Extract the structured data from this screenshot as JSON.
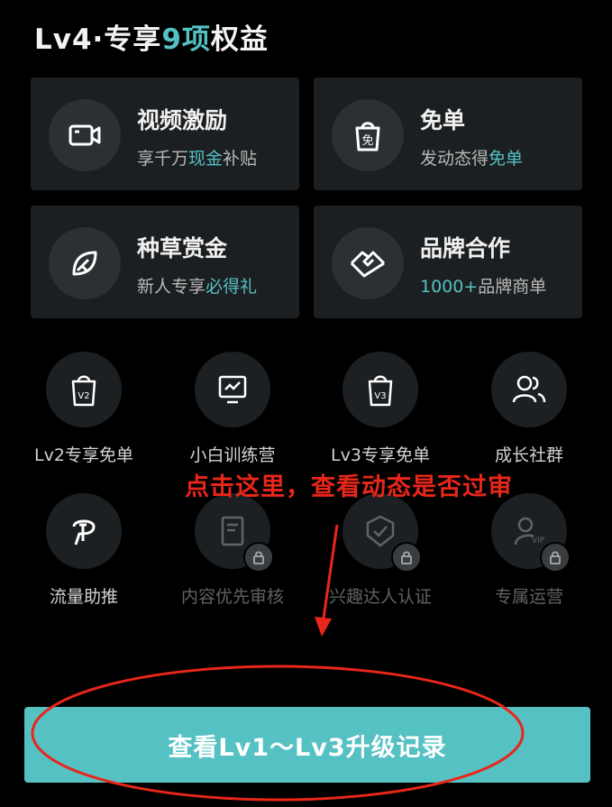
{
  "colors": {
    "accent": "#55c1c3",
    "annotation_red": "#e8261a",
    "background": "#000000",
    "card_bg": "#1c1f21"
  },
  "header": {
    "title_prefix": "Lv4·专享",
    "title_count": "9项",
    "title_suffix": "权益"
  },
  "big_cards": [
    {
      "icon": "video-camera-icon",
      "name": "视频激励",
      "desc_a": "享千万",
      "desc_hl": "现金",
      "desc_b": "补贴"
    },
    {
      "icon": "shopping-bag-free-icon",
      "name": "免单",
      "desc_a": "发动态得",
      "desc_hl": "免单",
      "desc_b": ""
    },
    {
      "icon": "leaf-icon",
      "name": "种草赏金",
      "desc_a": "新人专享",
      "desc_hl": "必得礼",
      "desc_b": ""
    },
    {
      "icon": "handshake-icon",
      "name": "品牌合作",
      "desc_a": "",
      "desc_hl": "1000+",
      "desc_b": "品牌商单"
    }
  ],
  "small_items": [
    {
      "icon": "lv2-bag-icon",
      "label": "Lv2专享免单",
      "locked": false
    },
    {
      "icon": "training-monitor-icon",
      "label": "小白训练营",
      "locked": false
    },
    {
      "icon": "lv3-bag-icon",
      "label": "Lv3专享免单",
      "locked": false
    },
    {
      "icon": "community-users-icon",
      "label": "成长社群",
      "locked": false
    },
    {
      "icon": "traffic-boost-icon",
      "label": "流量助推",
      "locked": false
    },
    {
      "icon": "priority-review-icon",
      "label": "内容优先审核",
      "locked": true
    },
    {
      "icon": "verified-shield-icon",
      "label": "兴趣达人认证",
      "locked": true
    },
    {
      "icon": "vip-operator-icon",
      "label": "专属运营",
      "locked": true
    }
  ],
  "annotation": {
    "text": "点击这里，查看动态是否过审"
  },
  "cta": {
    "label": "查看Lv1～Lv3升级记录"
  }
}
